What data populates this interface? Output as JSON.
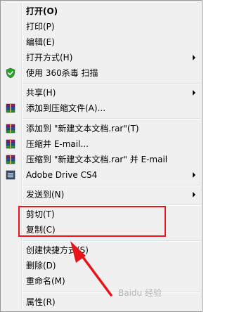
{
  "menu": {
    "items": [
      {
        "label": "打开(O)",
        "bold": true
      },
      {
        "label": "打印(P)"
      },
      {
        "label": "编辑(E)"
      },
      {
        "label": "打开方式(H)",
        "submenu": true
      },
      {
        "label": "使用 360杀毒 扫描",
        "icon": "shield-icon"
      },
      {
        "label": "共享(H)",
        "submenu": true
      },
      {
        "label": "添加到压缩文件(A)...",
        "icon": "winrar-books-icon"
      },
      {
        "label": "添加到 \"新建文本文档.rar\"(T)",
        "icon": "winrar-books-icon"
      },
      {
        "label": "压缩并 E-mail...",
        "icon": "winrar-books-icon"
      },
      {
        "label": "压缩到 \"新建文本文档.rar\" 并 E-mail",
        "icon": "winrar-books-icon"
      },
      {
        "label": "Adobe Drive CS4",
        "icon": "adobe-drive-icon",
        "submenu": true
      },
      {
        "label": "发送到(N)",
        "submenu": true
      },
      {
        "label": "剪切(T)"
      },
      {
        "label": "复制(C)"
      },
      {
        "label": "创建快捷方式(S)"
      },
      {
        "label": "删除(D)"
      },
      {
        "label": "重命名(M)"
      },
      {
        "label": "属性(R)"
      }
    ]
  },
  "annotation": {
    "highlight_color": "#e8141a",
    "target": "剪切(T) / 复制(C)"
  },
  "watermark": {
    "text": "Baidu 经验"
  },
  "colors": {
    "menu_bg": "#f0f0f0",
    "border": "#979797",
    "highlight": "#e8141a"
  }
}
